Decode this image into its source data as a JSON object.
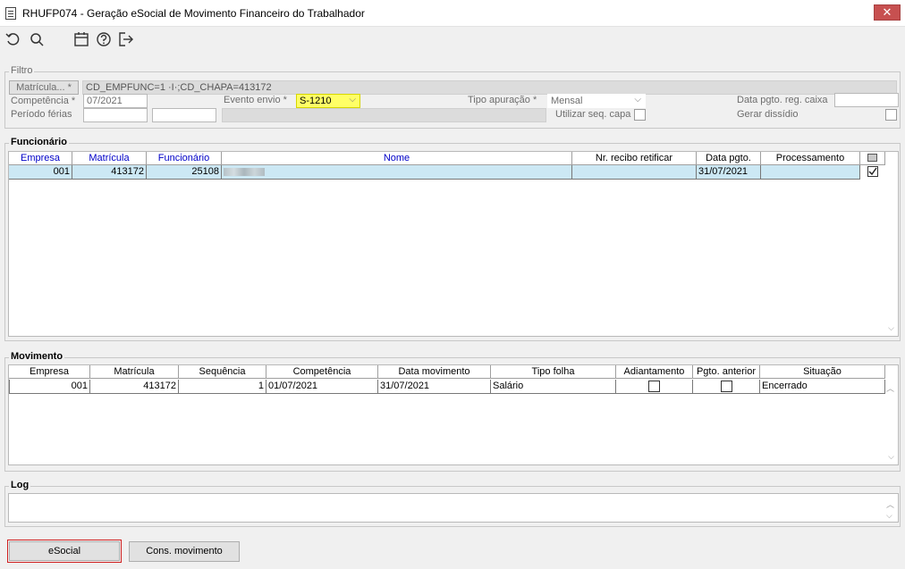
{
  "window": {
    "title": "RHUFP074 - Geração eSocial de Movimento Financeiro do Trabalhador",
    "close_label": "✕"
  },
  "toolbar": {
    "icons": [
      "undo-icon",
      "search-icon",
      "calendar-icon",
      "help-icon",
      "exit-icon"
    ]
  },
  "filtro": {
    "label": "Filtro",
    "matricula_button": "Matrícula... *",
    "matricula_value": "CD_EMPFUNC=1 ·I·;CD_CHAPA=413172",
    "competencia_label": "Competência *",
    "competencia_value": "07/2021",
    "evento_label": "Evento envio *",
    "evento_value": "S-1210",
    "tipo_apuracao_label": "Tipo apuração *",
    "tipo_apuracao_value": "Mensal",
    "data_pgto_label": "Data pgto. reg. caixa",
    "data_pgto_value": "",
    "periodo_ferias_label": "Período férias",
    "periodo_ferias_start": "",
    "periodo_ferias_end": "",
    "seq_capa_label": "Utilizar seq. capa",
    "gerar_dissidio_label": "Gerar dissídio"
  },
  "funcionario": {
    "label": "Funcionário",
    "columns": [
      "Empresa",
      "Matrícula",
      "Funcionário",
      "Nome",
      "Nr. recibo retificar",
      "Data pgto.",
      "Processamento"
    ],
    "rows": [
      {
        "empresa": "001",
        "matricula": "413172",
        "funcionario": "25108",
        "nome": "",
        "recibo": "",
        "data_pgto": "31/07/2021",
        "processamento": "",
        "checked": true
      }
    ]
  },
  "movimento": {
    "label": "Movimento",
    "columns": [
      "Empresa",
      "Matrícula",
      "Sequência",
      "Competência",
      "Data movimento",
      "Tipo folha",
      "Adiantamento",
      "Pgto. anterior",
      "Situação"
    ],
    "rows": [
      {
        "empresa": "001",
        "matricula": "413172",
        "sequencia": "1",
        "competencia": "01/07/2021",
        "data_movimento": "31/07/2021",
        "tipo_folha": "Salário",
        "adiantamento": false,
        "pgto_anterior": false,
        "situacao": "Encerrado"
      }
    ]
  },
  "log": {
    "label": "Log",
    "content": ""
  },
  "buttons": {
    "esocial": "eSocial",
    "cons_movimento": "Cons. movimento"
  },
  "colors": {
    "selection": "#cce8f4",
    "highlight": "#ffff66",
    "focus_border": "#d02020",
    "header_blue": "#0000c8"
  }
}
